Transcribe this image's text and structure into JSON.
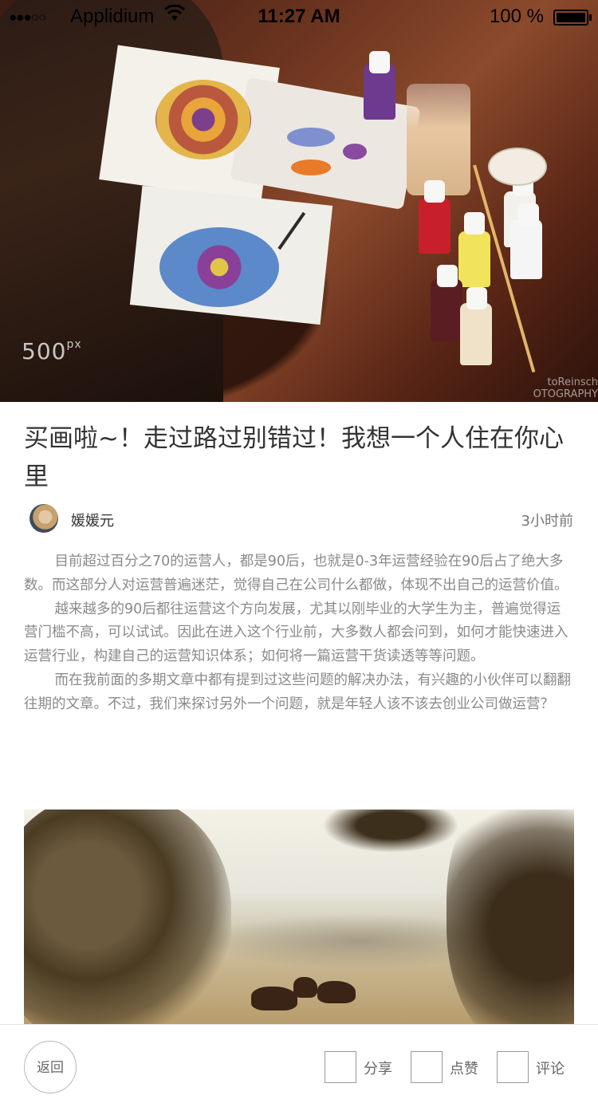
{
  "status_bar": {
    "signal_dots": "●●●○○",
    "carrier": "Applidium",
    "time": "11:27 AM",
    "battery": "100 %"
  },
  "hero_image": {
    "watermark": "500",
    "watermark_sup": "px",
    "credit_line1": "toReinsch",
    "credit_line2": "OTOGRAPHY"
  },
  "article": {
    "title": "买画啦~！走过路过别错过！我想一个人住在你心里",
    "author": {
      "name": "媛媛元",
      "posted": "3小时前"
    },
    "paragraphs": [
      "目前超过百分之70的运营人，都是90后，也就是0-3年运营经验在90后占了绝大多数。而这部分人对运营普遍迷茫，觉得自己在公司什么都做，体现不出自己的运营价值。",
      "越来越多的90后都往运营这个方向发展，尤其以刚毕业的大学生为主，普遍觉得运营门槛不高，可以试试。因此在进入这个行业前，大多数人都会问到，如何才能快速进入运营行业，构建自己的运营知识体系；如何将一篇运营干货读透等等问题。",
      "而在我前面的多期文章中都有提到过这些问题的解决办法，有兴趣的小伙伴可以翻翻往期的文章。不过，我们来探讨另外一个问题，就是年轻人该不该去创业公司做运营？"
    ]
  },
  "bottom_bar": {
    "back": "返回",
    "share": "分享",
    "like": "点赞",
    "comment": "评论"
  }
}
